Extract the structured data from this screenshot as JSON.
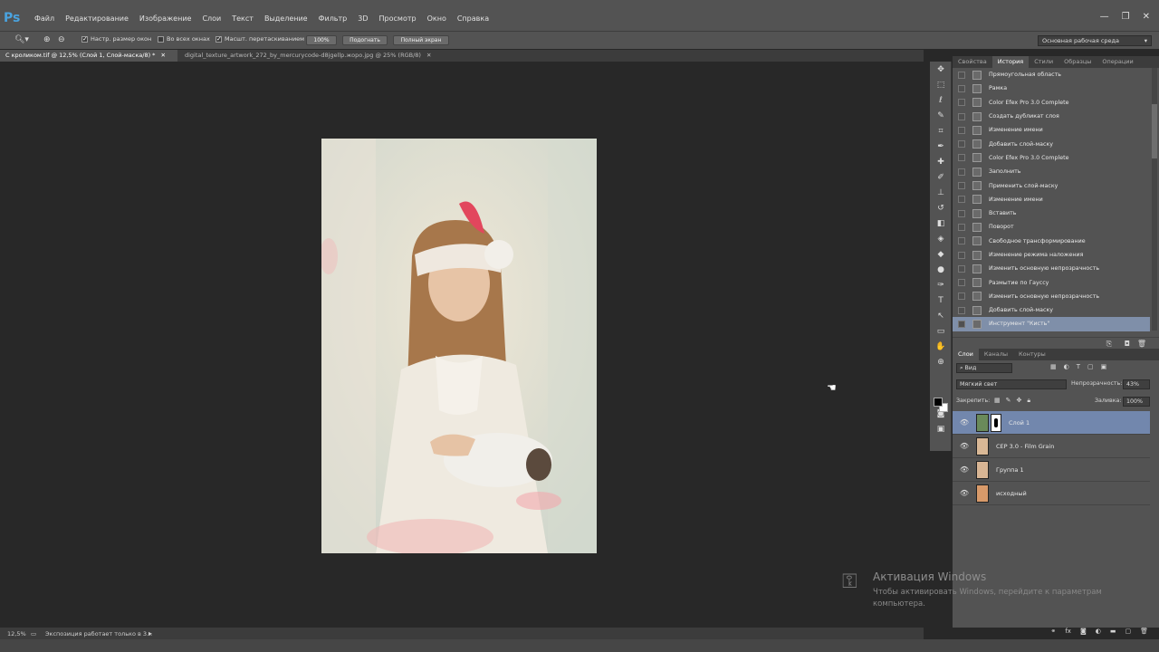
{
  "app": {
    "logo": "Ps"
  },
  "menu": [
    "Файл",
    "Редактирование",
    "Изображение",
    "Слои",
    "Текст",
    "Выделение",
    "Фильтр",
    "3D",
    "Просмотр",
    "Окно",
    "Справка"
  ],
  "window_controls": [
    "—",
    "❐",
    "✕"
  ],
  "options": {
    "resize_windows": "Настр. размер окон",
    "all_windows": "Во всех окнах",
    "scrubby_zoom": "Масшт. перетаскиванием",
    "btn_100": "100%",
    "btn_fit": "Подогнать",
    "btn_fullscreen": "Полный экран",
    "workspace": "Основная рабочая среда"
  },
  "tabs": [
    {
      "label": "С кроликом.tif @ 12,5% (Слой 1, Слой-маска/8) *",
      "close": "✕"
    },
    {
      "label": "digital_texture_artwork_272_by_mercurycode-d8jgellp.жоро.jpg @ 25% (RGB/8)",
      "close": "✕"
    }
  ],
  "status": {
    "zoom": "12,5%",
    "message": "Экспозиция работает только в 3..."
  },
  "history_panel": {
    "tabs": [
      "Свойства",
      "История",
      "Стили",
      "Образцы",
      "Операции"
    ],
    "active_tab": "История",
    "items": [
      "Прямоугольная область",
      "Рамка",
      "Color Efex Pro 3.0 Complete",
      "Создать дубликат слоя",
      "Изменение имени",
      "Добавить слой-маску",
      "Color Efex Pro 3.0 Complete",
      "Заполнить",
      "Применить слой-маску",
      "Изменение имени",
      "Вставить",
      "Поворот",
      "Свободное трансформирование",
      "Изменение режима наложения",
      "Изменить основную непрозрачность",
      "Размытие по Гауссу",
      "Изменить основную непрозрачность",
      "Добавить слой-маску",
      "Инструмент \"Кисть\""
    ],
    "selected_index": 18
  },
  "layers_panel": {
    "tabs": [
      "Слои",
      "Каналы",
      "Контуры"
    ],
    "active_tab": "Слои",
    "filter": "Вид",
    "blend_mode": "Мягкий свет",
    "opacity_label": "Непрозрачность:",
    "opacity_value": "43%",
    "lock_label": "Закрепить:",
    "fill_label": "Заливка:",
    "fill_value": "100%",
    "layers": [
      {
        "name": "Слой 1",
        "selected": true,
        "has_mask": true
      },
      {
        "name": "CEP 3.0 - Film Grain",
        "selected": false,
        "has_mask": false
      },
      {
        "name": "Группа 1",
        "selected": false,
        "has_mask": false
      },
      {
        "name": "исходный",
        "selected": false,
        "has_mask": false
      }
    ]
  },
  "watermark": {
    "title": "Активация Windows",
    "text": "Чтобы активировать Windows, перейдите к параметрам компьютера."
  },
  "colors": {
    "selection_history": "#7f8fa9",
    "selection_layer": "#7287ad",
    "panel_bg": "#535353",
    "canvas_bg": "#282828"
  }
}
